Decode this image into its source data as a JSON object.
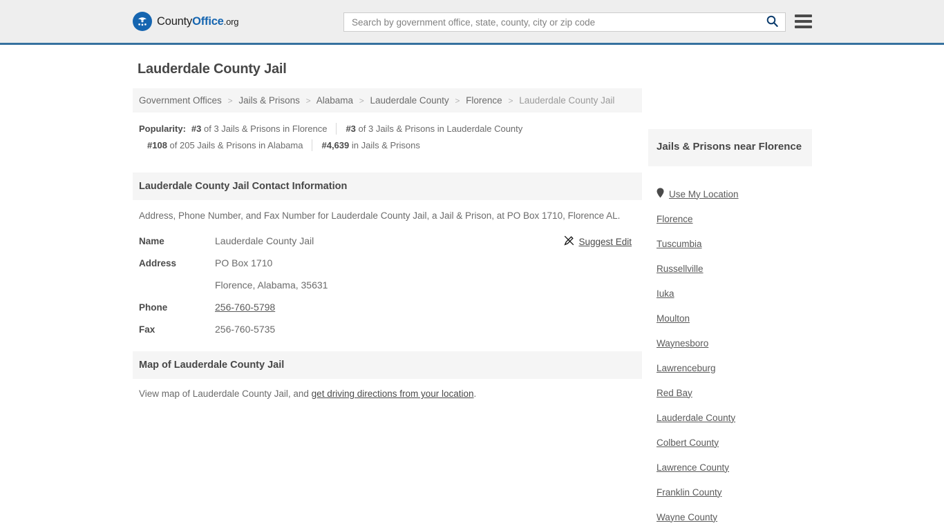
{
  "header": {
    "logo": {
      "icon": "eagle-seal-icon",
      "text_county": "County",
      "text_office": "Office",
      "text_org": ".org"
    },
    "search": {
      "placeholder": "Search by government office, state, county, city or zip code",
      "value": "",
      "icon": "search-icon"
    },
    "menu_icon": "hamburger-menu-icon",
    "accent_color": "#36719f"
  },
  "main": {
    "page_title": "Lauderdale County Jail",
    "breadcrumb": [
      {
        "label": "Government Offices",
        "current": false
      },
      {
        "label": "Jails & Prisons",
        "current": false
      },
      {
        "label": "Alabama",
        "current": false
      },
      {
        "label": "Lauderdale County",
        "current": false
      },
      {
        "label": "Florence",
        "current": false
      },
      {
        "label": "Lauderdale County Jail",
        "current": true
      }
    ],
    "breadcrumb_separator": ">",
    "popularity": {
      "label": "Popularity:",
      "row1": [
        {
          "rank": "#3",
          "text": " of 3 Jails & Prisons in Florence"
        },
        {
          "rank": "#3",
          "text": " of 3 Jails & Prisons in Lauderdale County"
        }
      ],
      "row2": [
        {
          "rank": "#108",
          "text": " of 205 Jails & Prisons in Alabama"
        },
        {
          "rank": "#4,639",
          "text": " in Jails & Prisons"
        }
      ]
    },
    "contact_section": {
      "heading": "Lauderdale County Jail Contact Information",
      "description": "Address, Phone Number, and Fax Number for Lauderdale County Jail, a Jail & Prison, at PO Box 1710, Florence AL.",
      "suggest_edit": {
        "label": "Suggest Edit",
        "icon": "pencil-edit-icon"
      },
      "rows": [
        {
          "key": "Name",
          "value": "Lauderdale County Jail",
          "link": false
        },
        {
          "key": "Address",
          "value": "PO Box 1710",
          "link": false
        },
        {
          "key": "",
          "value": "Florence, Alabama, 35631",
          "link": false
        },
        {
          "key": "Phone",
          "value": "256-760-5798",
          "link": true
        },
        {
          "key": "Fax",
          "value": "256-760-5735",
          "link": false
        }
      ]
    },
    "map_section": {
      "heading": "Map of Lauderdale County Jail",
      "text_before": "View map of Lauderdale County Jail, and ",
      "link_text": "get driving directions from your location",
      "text_after": "."
    }
  },
  "sidebar": {
    "heading": "Jails & Prisons near Florence",
    "location_icon": "map-pin-icon",
    "items": [
      {
        "label": "Use My Location",
        "has_icon": true
      },
      {
        "label": "Florence",
        "has_icon": false
      },
      {
        "label": "Tuscumbia",
        "has_icon": false
      },
      {
        "label": "Russellville",
        "has_icon": false
      },
      {
        "label": "Iuka",
        "has_icon": false
      },
      {
        "label": "Moulton",
        "has_icon": false
      },
      {
        "label": "Waynesboro",
        "has_icon": false
      },
      {
        "label": "Lawrenceburg",
        "has_icon": false
      },
      {
        "label": "Red Bay",
        "has_icon": false
      },
      {
        "label": "Lauderdale County",
        "has_icon": false
      },
      {
        "label": "Colbert County",
        "has_icon": false
      },
      {
        "label": "Lawrence County",
        "has_icon": false
      },
      {
        "label": "Franklin County",
        "has_icon": false
      },
      {
        "label": "Wayne County",
        "has_icon": false
      }
    ]
  }
}
